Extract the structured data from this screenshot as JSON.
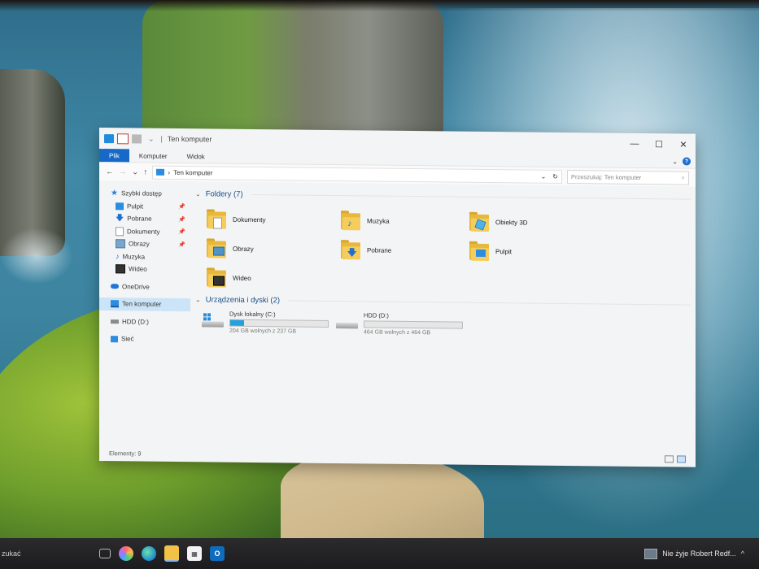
{
  "window": {
    "title": "Ten komputer",
    "controls": {
      "minimize": "—",
      "maximize": "☐",
      "close": "✕"
    }
  },
  "ribbon": {
    "tabs": [
      "Plik",
      "Komputer",
      "Widok"
    ],
    "expand": "⌄",
    "help": "?"
  },
  "address": {
    "back": "←",
    "forward": "→",
    "recent": "⌄",
    "up": "↑",
    "separator": "›",
    "path": "Ten komputer",
    "dropdown": "⌄",
    "refresh": "↻",
    "search_placeholder": "Przeszukaj: Ten komputer",
    "search_icon": "⌕"
  },
  "nav": {
    "quick_access": "Szybki dostęp",
    "items": [
      "Pulpit",
      "Pobrane",
      "Dokumenty",
      "Obrazy",
      "Muzyka",
      "Wideo"
    ],
    "pin": "📌",
    "onedrive": "OneDrive",
    "this_pc": "Ten komputer",
    "hdd": "HDD (D:)",
    "network": "Sieć"
  },
  "folders": {
    "heading": "Foldery (7)",
    "chev": "⌄",
    "items": [
      "Dokumenty",
      "Muzyka",
      "Obiekty 3D",
      "Obrazy",
      "Pobrane",
      "Pulpit",
      "Wideo"
    ]
  },
  "drives": {
    "heading": "Urządzenia i dyski (2)",
    "chev": "⌄",
    "items": [
      {
        "name": "Dysk lokalny (C:)",
        "free": "204 GB wolnych z 237 GB",
        "used_fraction": 0.14
      },
      {
        "name": "HDD (D:)",
        "free": "464 GB wolnych z 464 GB",
        "used_fraction": 0.0
      }
    ]
  },
  "status": {
    "count": "Elementy: 9"
  },
  "taskbar": {
    "search_text": "zukać",
    "news": "Nie żyje Robert Redf...",
    "tray_chevron": "^"
  },
  "colors": {
    "accent": "#1669c7",
    "drive_fill": "#26a0da",
    "folder": "#f5cd5c",
    "selection": "#cce4f7"
  }
}
